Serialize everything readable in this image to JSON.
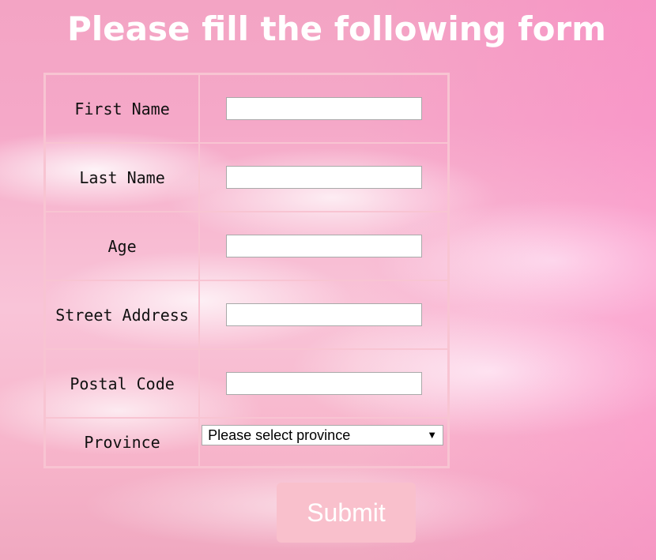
{
  "header": {
    "title": "Please fill the following form"
  },
  "form": {
    "fields": [
      {
        "label": "First Name",
        "value": ""
      },
      {
        "label": "Last Name",
        "value": ""
      },
      {
        "label": "Age",
        "value": ""
      },
      {
        "label": "Street Address",
        "value": ""
      },
      {
        "label": "Postal Code",
        "value": ""
      }
    ],
    "province": {
      "label": "Province",
      "selected": "Please select province"
    },
    "submit_label": "Submit"
  },
  "colors": {
    "background_pink": "#f5a8c8",
    "table_border": "#f8c4d2",
    "submit_background": "#f9c0cc",
    "title_text": "#ffffff"
  },
  "icons": {
    "select_arrow": "triangle-down-icon"
  }
}
